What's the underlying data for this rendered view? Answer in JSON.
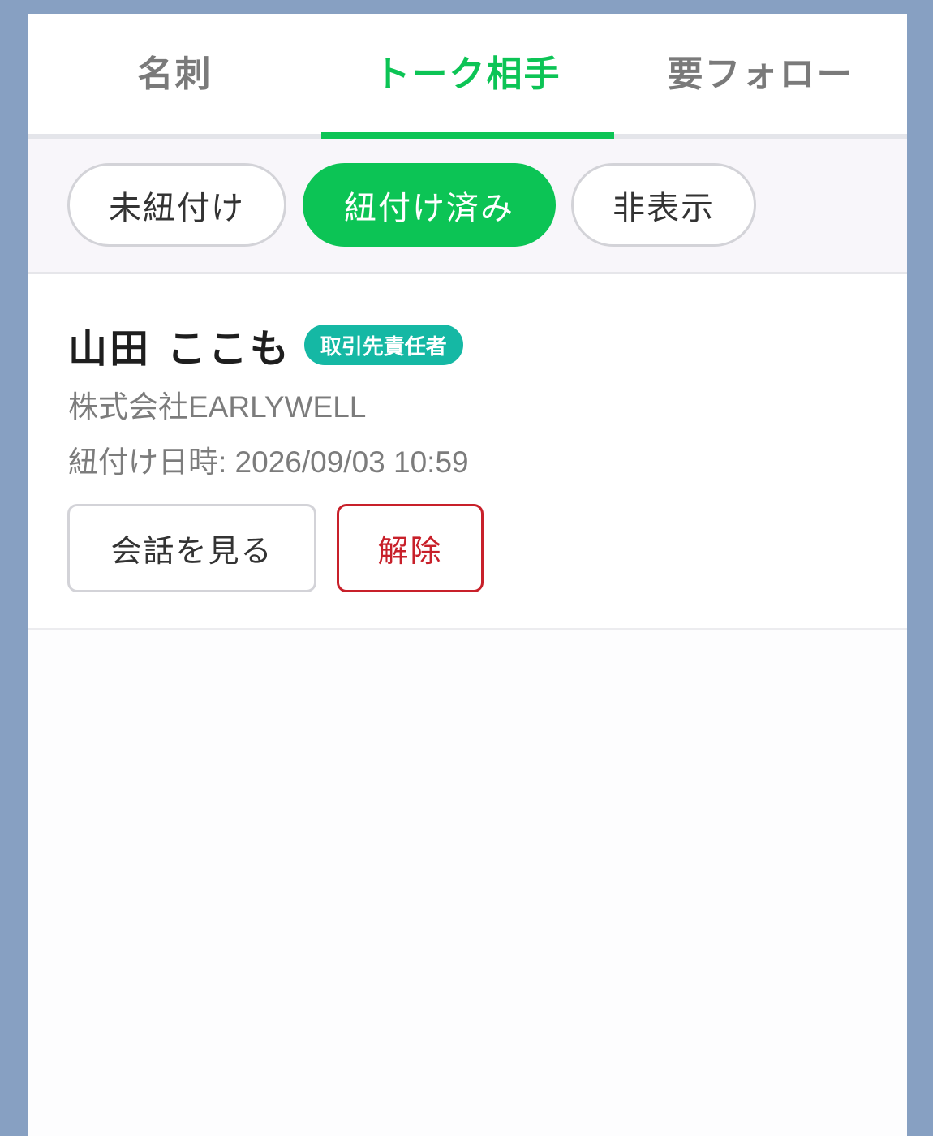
{
  "tabs": [
    {
      "label": "名刺",
      "active": false
    },
    {
      "label": "トーク相手",
      "active": true
    },
    {
      "label": "要フォロー",
      "active": false
    }
  ],
  "filters": [
    {
      "label": "未紐付け",
      "active": false
    },
    {
      "label": "紐付け済み",
      "active": true
    },
    {
      "label": "非表示",
      "active": false
    }
  ],
  "contact": {
    "name": "山田 ここも",
    "role_badge": "取引先責任者",
    "company": "株式会社EARLYWELL",
    "linked_at": "紐付け日時: 2026/09/03 10:59",
    "view_button": "会話を見る",
    "unlink_button": "解除"
  },
  "colors": {
    "accent_green": "#0cc455",
    "badge_teal": "#15b8a4",
    "danger_red": "#c8202a",
    "frame_blue": "#87a0c2"
  }
}
